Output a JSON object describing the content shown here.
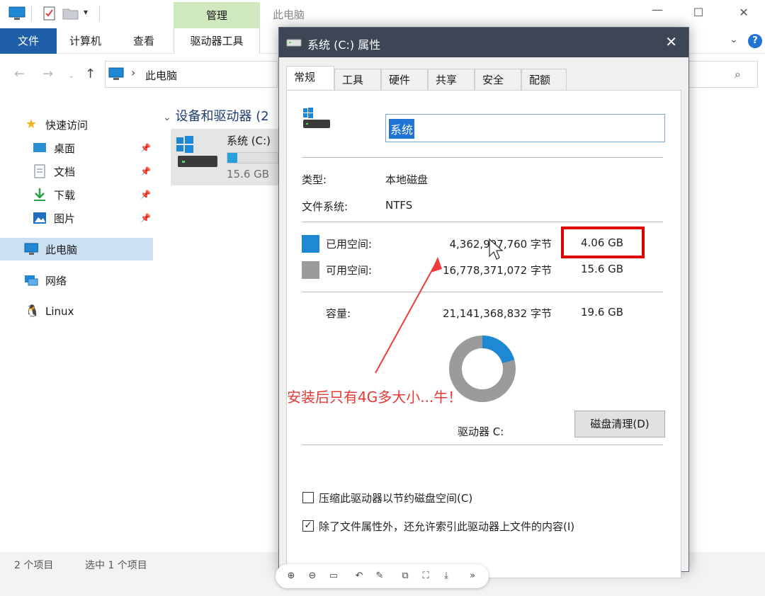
{
  "explorer": {
    "manage_tab": "管理",
    "window_title": "此电脑",
    "ribbon": {
      "file": "文件",
      "computer": "计算机",
      "view": "查看",
      "drive_tools": "驱动器工具"
    },
    "address": {
      "separator": "›",
      "location": "此电脑"
    },
    "nav": {
      "quick_access": "快速访问",
      "desktop": "桌面",
      "documents": "文档",
      "downloads": "下载",
      "pictures": "图片",
      "this_pc": "此电脑",
      "network": "网络",
      "linux": "Linux"
    },
    "content": {
      "group_header": "设备和驱动器 (2",
      "drive_name": "系统 (C:)",
      "drive_free": "15.6 GB",
      "drive_used_fraction": 0.2
    },
    "status": {
      "items": "2 个项目",
      "selected": "选中 1 个项目"
    }
  },
  "dialog": {
    "title": "系统 (C:) 属性",
    "tabs": [
      "常规",
      "工具",
      "硬件",
      "共享",
      "安全",
      "配额"
    ],
    "volume_name": "系统",
    "type_label": "类型:",
    "type_value": "本地磁盘",
    "fs_label": "文件系统:",
    "fs_value": "NTFS",
    "used_label": "已用空间:",
    "used_bytes": "4,362,997,760 字节",
    "used_size": "4.06 GB",
    "free_label": "可用空间:",
    "free_bytes": "16,778,371,072 字节",
    "free_size": "15.6 GB",
    "capacity_label": "容量:",
    "capacity_bytes": "21,141,368,832 字节",
    "capacity_size": "19.6 GB",
    "used_fraction": 0.206,
    "drive_label": "驱动器 C:",
    "cleanup_button": "磁盘清理(D)",
    "compress_label": "压缩此驱动器以节约磁盘空间(C)",
    "compress_checked": false,
    "index_label": "除了文件属性外，还允许索引此驱动器上文件的内容(I)",
    "index_checked": true
  },
  "annotation": "安装后只有4G多大小...牛！",
  "colors": {
    "used": "#1e88d4",
    "free": "#9b9b9b",
    "highlight": "#e00000",
    "annotation": "#e53935",
    "file_tab": "#1f5fa8",
    "manage_tab": "#cfe8bd",
    "dialog_title": "#3c4654"
  },
  "viewer_toolbar": {
    "icons": [
      "zoom-in-icon",
      "zoom-out-icon",
      "fit-icon",
      "rotate-icon",
      "edit-icon",
      "copy-icon",
      "scan-icon",
      "download-icon",
      "more-icon"
    ]
  }
}
